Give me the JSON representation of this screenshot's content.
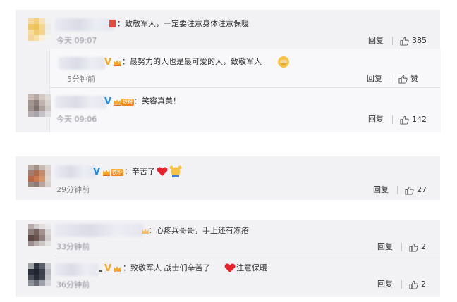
{
  "comments": [
    {
      "text": "：致敬军人，一定要注意身体注意保暖",
      "time": "今天 09:07",
      "reply": "回复",
      "likes": "385"
    },
    {
      "text": "：最努力的人也是最可爱的人，致敬军人",
      "time": "5分钟前",
      "reply": "回复",
      "likes": "赞"
    },
    {
      "text": "：笑容真美！",
      "time": "今天 09:06",
      "reply": "回复",
      "likes": "142",
      "badge": "铁粉"
    },
    {
      "text": "：辛苦了",
      "time": "29分钟前",
      "reply": "回复",
      "likes": "27",
      "badge": "铁粉"
    },
    {
      "text": "：心疼兵哥哥，手上还有冻疮",
      "time": "33分钟前",
      "reply": "回复",
      "likes": "2"
    },
    {
      "text": "：致敬军人  战士们辛苦了",
      "text_after": "注意保暖",
      "time": "36分钟前",
      "reply": "回复",
      "likes": "2"
    }
  ],
  "verified_mark": "V",
  "colors": {
    "card_bg": "#f2f2f5",
    "verified": "#1e88e5",
    "heart": "#e8202a",
    "text": "#333333",
    "meta": "#808080"
  },
  "icons": [
    "thumb-up-icon",
    "heart-icon",
    "crown-icon",
    "verified-v-icon",
    "medal-icon",
    "hands-up-emoji",
    "hug-emoji"
  ]
}
